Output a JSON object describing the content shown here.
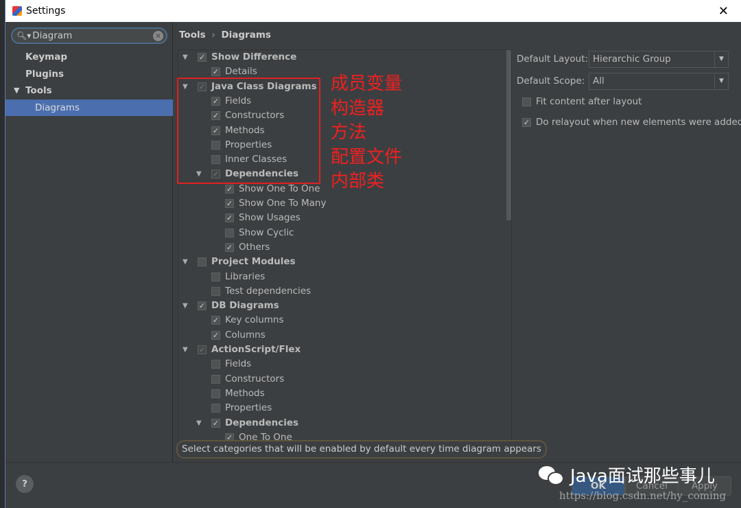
{
  "window": {
    "title": "Settings",
    "close_icon": "close-icon"
  },
  "sidebar": {
    "search_value": "Diagram",
    "items": [
      {
        "label": "Keymap",
        "selected": false,
        "expandable": false,
        "level": 0
      },
      {
        "label": "Plugins",
        "selected": false,
        "expandable": false,
        "level": 0
      },
      {
        "label": "Tools",
        "selected": false,
        "expandable": true,
        "level": 0
      },
      {
        "label": "Diagrams",
        "selected": true,
        "expandable": false,
        "level": 1
      }
    ]
  },
  "breadcrumb": {
    "parent": "Tools",
    "sep": "›",
    "current": "Diagrams"
  },
  "tree": [
    {
      "label": "Show Difference",
      "level": 0,
      "arrow": true,
      "bold": true,
      "state": "checked"
    },
    {
      "label": "Details",
      "level": 1,
      "state": "checked"
    },
    {
      "label": "Java Class Diagrams",
      "level": 0,
      "arrow": true,
      "bold": true,
      "state": "partial"
    },
    {
      "label": "Fields",
      "level": 1,
      "state": "checked"
    },
    {
      "label": "Constructors",
      "level": 1,
      "state": "checked"
    },
    {
      "label": "Methods",
      "level": 1,
      "state": "checked"
    },
    {
      "label": "Properties",
      "level": 1,
      "state": "unchecked"
    },
    {
      "label": "Inner Classes",
      "level": 1,
      "state": "unchecked"
    },
    {
      "label": "Dependencies",
      "level": 1,
      "arrow": true,
      "bold": true,
      "state": "partial"
    },
    {
      "label": "Show One To One",
      "level": 2,
      "state": "checked"
    },
    {
      "label": "Show One To Many",
      "level": 2,
      "state": "checked"
    },
    {
      "label": "Show Usages",
      "level": 2,
      "state": "checked"
    },
    {
      "label": "Show Cyclic",
      "level": 2,
      "state": "unchecked"
    },
    {
      "label": "Others",
      "level": 2,
      "state": "checked"
    },
    {
      "label": "Project Modules",
      "level": 0,
      "arrow": true,
      "bold": true,
      "state": "unchecked"
    },
    {
      "label": "Libraries",
      "level": 1,
      "state": "unchecked"
    },
    {
      "label": "Test dependencies",
      "level": 1,
      "state": "unchecked"
    },
    {
      "label": "DB Diagrams",
      "level": 0,
      "arrow": true,
      "bold": true,
      "state": "checked"
    },
    {
      "label": "Key columns",
      "level": 1,
      "state": "checked"
    },
    {
      "label": "Columns",
      "level": 1,
      "state": "checked"
    },
    {
      "label": "ActionScript/Flex",
      "level": 0,
      "arrow": true,
      "bold": true,
      "state": "partial"
    },
    {
      "label": "Fields",
      "level": 1,
      "state": "unchecked"
    },
    {
      "label": "Constructors",
      "level": 1,
      "state": "unchecked"
    },
    {
      "label": "Methods",
      "level": 1,
      "state": "unchecked"
    },
    {
      "label": "Properties",
      "level": 1,
      "state": "unchecked"
    },
    {
      "label": "Dependencies",
      "level": 1,
      "arrow": true,
      "bold": true,
      "state": "checked"
    },
    {
      "label": "One To One",
      "level": 2,
      "state": "checked"
    }
  ],
  "options": {
    "layout_label": "Default Layout:",
    "layout_value": "Hierarchic Group",
    "scope_label": "Default Scope:",
    "scope_value": "All",
    "fit_label": "Fit content after layout",
    "fit_checked": false,
    "relayout_label": "Do relayout when new elements were added",
    "relayout_checked": true
  },
  "hint": "Select categories that will be enabled by default every time diagram appears",
  "buttons": {
    "help": "?",
    "ok": "OK",
    "cancel": "Cancel",
    "apply": "Apply"
  },
  "annotation": {
    "color": "#f02020",
    "lines": [
      "成员变量",
      "构造器",
      "方法",
      "配置文件",
      "内部类"
    ]
  },
  "watermark": {
    "text": "Java面试那些事儿",
    "url": "https://blog.csdn.net/hy_coming"
  }
}
